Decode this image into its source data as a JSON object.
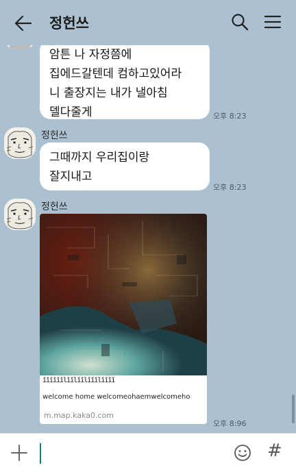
{
  "header": {
    "title": "정헌쓰",
    "back_icon": "arrow-left-icon",
    "search_icon": "search-icon",
    "menu_icon": "hamburger-menu-icon"
  },
  "messages": [
    {
      "sender": "",
      "lines": [
        "암튼 나 자정쯤에",
        "집에드갈텐데 컴하고있어라",
        "니 출장지는 내가 낼아침",
        "델다줄게"
      ],
      "time": "오후 8:23"
    },
    {
      "sender": "정헌쓰",
      "lines": [
        "그때까지 우리집이랑",
        "잘지내고"
      ],
      "time": "오후 8:23"
    },
    {
      "sender": "정헌쓰",
      "link_preview": {
        "garbled_title": "ǐǐǐǐǐǐlǐǐlǐǐlǐǐǐlǐǐǐǐ",
        "garbled_subtitle": "welcome home welcomeohaemwelcomeho",
        "domain": "m.map.kaka0.com"
      },
      "time": "오후 8:96"
    }
  ],
  "input": {
    "plus_icon": "plus-icon",
    "emoji_icon": "emoji-icon",
    "hash_label": "#"
  },
  "colors": {
    "background": "#abc1d1",
    "bubble": "#ffffff",
    "cursor": "#0f7d7a"
  }
}
